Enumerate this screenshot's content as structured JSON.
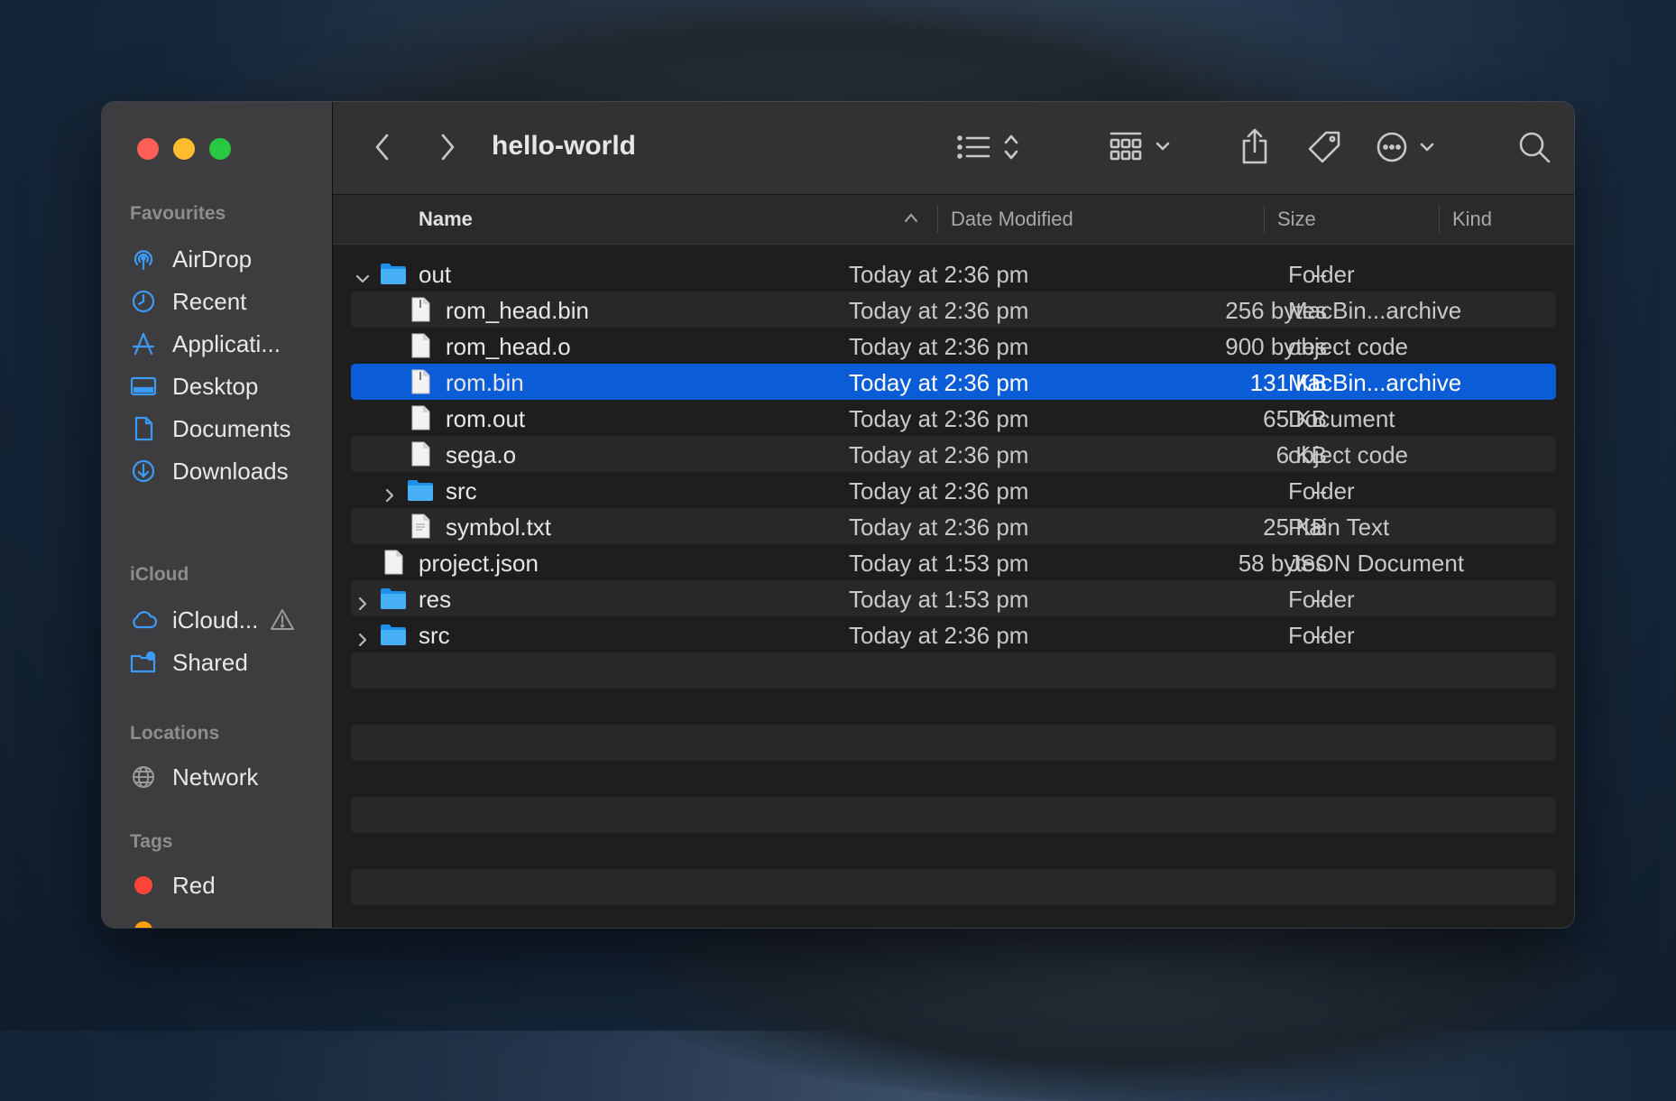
{
  "window": {
    "title": "hello-world"
  },
  "sidebar": {
    "sections": {
      "favourites": "Favourites",
      "icloud": "iCloud",
      "locations": "Locations",
      "tags": "Tags"
    },
    "favourites": [
      {
        "label": "AirDrop",
        "icon": "airdrop-icon"
      },
      {
        "label": "Recent",
        "icon": "clock-icon"
      },
      {
        "label": "Applicati...",
        "icon": "applications-icon"
      },
      {
        "label": "Desktop",
        "icon": "desktop-icon"
      },
      {
        "label": "Documents",
        "icon": "document-icon"
      },
      {
        "label": "Downloads",
        "icon": "download-icon"
      }
    ],
    "icloud": [
      {
        "label": "iCloud...",
        "icon": "cloud-icon",
        "warning_icon": "warning-icon"
      },
      {
        "label": "Shared",
        "icon": "shared-folder-icon"
      }
    ],
    "locations": [
      {
        "label": "Network",
        "icon": "globe-icon"
      }
    ],
    "tags": [
      {
        "label": "Red",
        "color": "#ff453a"
      }
    ]
  },
  "toolbar": {
    "back_icon": "chevron-left-icon",
    "forward_icon": "chevron-right-icon",
    "view_icon": "list-view-icon",
    "group_icon": "group-grid-icon",
    "share_icon": "share-icon",
    "tag_icon": "tag-icon",
    "more_icon": "ellipsis-circle-icon",
    "search_icon": "search-icon"
  },
  "columns": {
    "name": "Name",
    "date": "Date Modified",
    "size": "Size",
    "kind": "Kind"
  },
  "files": [
    {
      "name": "out",
      "date": "Today at 2:36 pm",
      "size": "--",
      "kind": "Folder",
      "type": "folder",
      "level": 0,
      "expanded": true
    },
    {
      "name": "rom_head.bin",
      "date": "Today at 2:36 pm",
      "size": "256 bytes",
      "kind": "MacBin...archive",
      "type": "binary",
      "level": 1
    },
    {
      "name": "rom_head.o",
      "date": "Today at 2:36 pm",
      "size": "900 bytes",
      "kind": "object code",
      "type": "file",
      "level": 1
    },
    {
      "name": "rom.bin",
      "date": "Today at 2:36 pm",
      "size": "131 KB",
      "kind": "MacBin...archive",
      "type": "binary",
      "level": 1,
      "selected": true
    },
    {
      "name": "rom.out",
      "date": "Today at 2:36 pm",
      "size": "65 KB",
      "kind": "Document",
      "type": "file",
      "level": 1
    },
    {
      "name": "sega.o",
      "date": "Today at 2:36 pm",
      "size": "6 KB",
      "kind": "object code",
      "type": "file",
      "level": 1
    },
    {
      "name": "src",
      "date": "Today at 2:36 pm",
      "size": "--",
      "kind": "Folder",
      "type": "folder",
      "level": 1,
      "expanded": false
    },
    {
      "name": "symbol.txt",
      "date": "Today at 2:36 pm",
      "size": "25 KB",
      "kind": "Plain Text",
      "type": "text",
      "level": 1
    },
    {
      "name": "project.json",
      "date": "Today at 1:53 pm",
      "size": "58 bytes",
      "kind": "JSON Document",
      "type": "file",
      "level": 0
    },
    {
      "name": "res",
      "date": "Today at 1:53 pm",
      "size": "--",
      "kind": "Folder",
      "type": "folder",
      "level": 0,
      "expanded": false
    },
    {
      "name": "src",
      "date": "Today at 2:36 pm",
      "size": "--",
      "kind": "Folder",
      "type": "folder",
      "level": 0,
      "expanded": false
    }
  ]
}
